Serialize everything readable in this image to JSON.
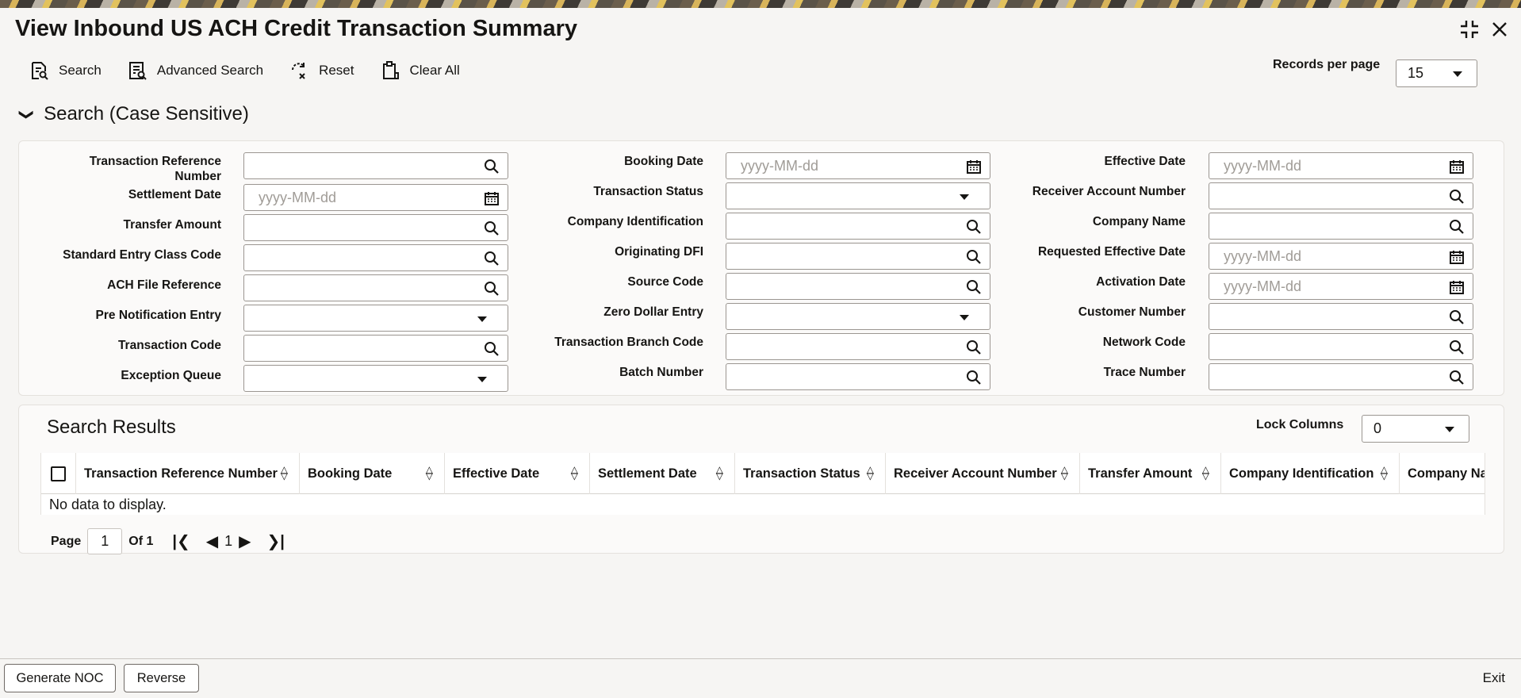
{
  "page": {
    "title": "View Inbound US ACH Credit Transaction Summary"
  },
  "toolbar": {
    "search": "Search",
    "advanced_search": "Advanced Search",
    "reset": "Reset",
    "clear_all": "Clear All",
    "records_per_page_label": "Records per page",
    "records_per_page_value": "15"
  },
  "search_section": {
    "title": "Search (Case Sensitive)",
    "fields": {
      "transaction_reference_number": {
        "label": "Transaction Reference Number"
      },
      "settlement_date": {
        "label": "Settlement Date",
        "placeholder": "yyyy-MM-dd"
      },
      "transfer_amount": {
        "label": "Transfer Amount"
      },
      "standard_entry_class_code": {
        "label": "Standard Entry Class Code"
      },
      "ach_file_reference": {
        "label": "ACH File Reference"
      },
      "pre_notification_entry": {
        "label": "Pre Notification Entry"
      },
      "transaction_code": {
        "label": "Transaction Code"
      },
      "exception_queue": {
        "label": "Exception Queue"
      },
      "booking_date": {
        "label": "Booking Date",
        "placeholder": "yyyy-MM-dd"
      },
      "transaction_status": {
        "label": "Transaction Status"
      },
      "company_identification": {
        "label": "Company Identification"
      },
      "originating_dfi": {
        "label": "Originating DFI"
      },
      "source_code": {
        "label": "Source Code"
      },
      "zero_dollar_entry": {
        "label": "Zero Dollar Entry"
      },
      "transaction_branch_code": {
        "label": "Transaction Branch Code"
      },
      "batch_number": {
        "label": "Batch Number"
      },
      "effective_date": {
        "label": "Effective Date",
        "placeholder": "yyyy-MM-dd"
      },
      "receiver_account_number": {
        "label": "Receiver Account Number"
      },
      "company_name": {
        "label": "Company Name"
      },
      "requested_effective_date": {
        "label": "Requested Effective Date",
        "placeholder": "yyyy-MM-dd"
      },
      "activation_date": {
        "label": "Activation Date",
        "placeholder": "yyyy-MM-dd"
      },
      "customer_number": {
        "label": "Customer Number"
      },
      "network_code": {
        "label": "Network Code"
      },
      "trace_number": {
        "label": "Trace Number"
      }
    }
  },
  "results": {
    "title": "Search Results",
    "lock_columns_label": "Lock Columns",
    "lock_columns_value": "0",
    "columns": [
      "Transaction Reference Number",
      "Booking Date",
      "Effective Date",
      "Settlement Date",
      "Transaction Status",
      "Receiver Account Number",
      "Transfer Amount",
      "Company Identification",
      "Company Name"
    ],
    "empty_message": "No data to display.",
    "pager": {
      "page_label": "Page",
      "page_value": "1",
      "of_label": "Of 1",
      "current": "1"
    }
  },
  "footer": {
    "generate_noc": "Generate NOC",
    "reverse": "Reverse",
    "exit": "Exit"
  }
}
